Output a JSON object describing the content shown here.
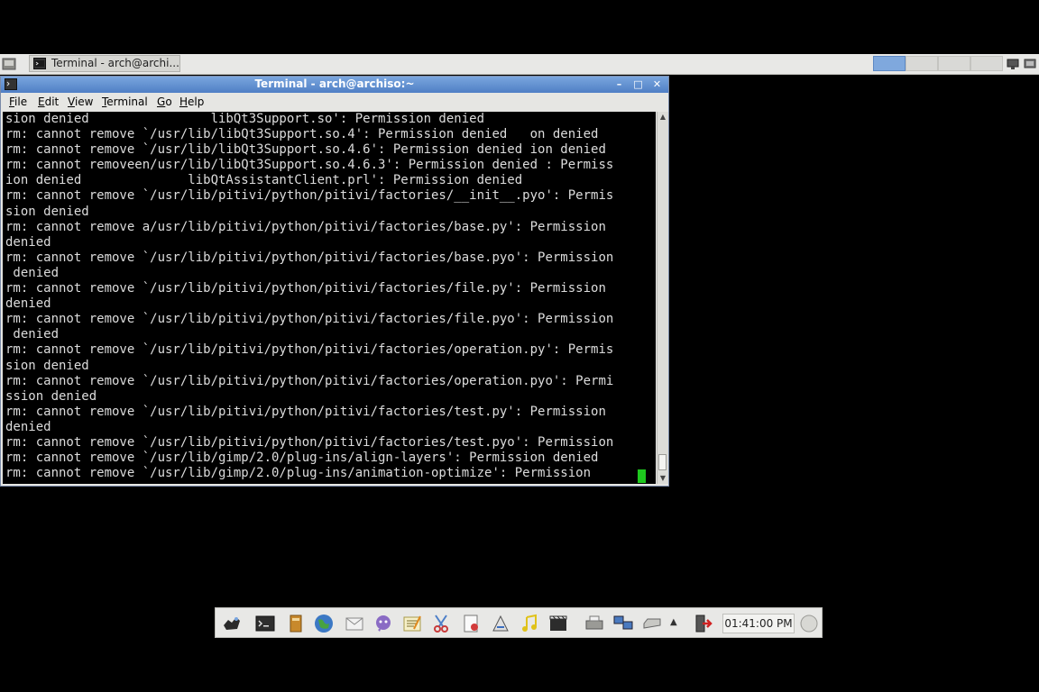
{
  "taskbar": {
    "window_button_label": "Terminal - arch@archi..."
  },
  "window": {
    "title": "Terminal - arch@archiso:~",
    "controls": [
      "minimize",
      "maximize",
      "close"
    ]
  },
  "menu": {
    "items": [
      {
        "first": "F",
        "rest": "ile"
      },
      {
        "first": "E",
        "rest": "dit"
      },
      {
        "first": "V",
        "rest": "iew"
      },
      {
        "first": "T",
        "rest": "erminal"
      },
      {
        "first": "G",
        "rest": "o"
      },
      {
        "first": "H",
        "rest": "elp"
      }
    ]
  },
  "terminal": {
    "lines": [
      "sion denied                libQt3Support.so': Permission denied",
      "rm: cannot remove `/usr/lib/libQt3Support.so.4': Permission denied   on denied",
      "rm: cannot remove `/usr/lib/libQt3Support.so.4.6': Permission denied ion denied",
      "rm: cannot removeen/usr/lib/libQt3Support.so.4.6.3': Permission denied : Permiss",
      "ion denied              libQtAssistantClient.prl': Permission denied",
      "rm: cannot remove `/usr/lib/pitivi/python/pitivi/factories/__init__.pyo': Permis",
      "sion denied",
      "rm: cannot remove a/usr/lib/pitivi/python/pitivi/factories/base.py': Permission",
      "denied",
      "rm: cannot remove `/usr/lib/pitivi/python/pitivi/factories/base.pyo': Permission",
      " denied",
      "rm: cannot remove `/usr/lib/pitivi/python/pitivi/factories/file.py': Permission",
      "denied",
      "rm: cannot remove `/usr/lib/pitivi/python/pitivi/factories/file.pyo': Permission",
      " denied",
      "rm: cannot remove `/usr/lib/pitivi/python/pitivi/factories/operation.py': Permis",
      "sion denied",
      "rm: cannot remove `/usr/lib/pitivi/python/pitivi/factories/operation.pyo': Permi",
      "ssion denied",
      "rm: cannot remove `/usr/lib/pitivi/python/pitivi/factories/test.py': Permission",
      "denied",
      "rm: cannot remove `/usr/lib/pitivi/python/pitivi/factories/test.pyo': Permission",
      "rm: cannot remove `/usr/lib/gimp/2.0/plug-ins/align-layers': Permission denied",
      "rm: cannot remove `/usr/lib/gimp/2.0/plug-ins/animation-optimize': Permission"
    ]
  },
  "dock": {
    "clock": "01:41:00 PM",
    "icons": [
      "xfce-mouse-icon",
      "terminal-icon",
      "file-manager-icon",
      "web-browser-icon",
      "mail-icon",
      "chat-icon",
      "text-editor-icon",
      "screenshot-scissors-icon",
      "document-viewer-icon",
      "graphics-icon",
      "music-icon",
      "video-icon"
    ],
    "tray_icons": [
      "printer-icon",
      "network-icon",
      "drive-icon",
      "logout-icon"
    ]
  },
  "colors": {
    "titlebar": "#5a88cc",
    "terminal_bg": "#000000",
    "terminal_fg": "#dcdcdc",
    "cursor": "#1ec81e",
    "panel_bg": "#e8e8e6"
  }
}
